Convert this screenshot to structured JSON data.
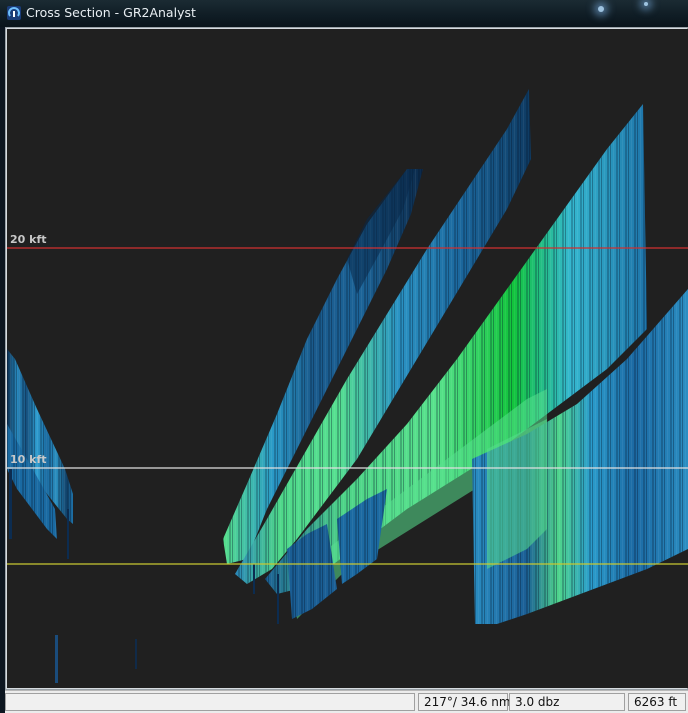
{
  "window": {
    "title": "Cross Section - GR2Analyst"
  },
  "cross_section": {
    "altitude_lines": [
      {
        "label": "20 kft",
        "color": "#d03030"
      },
      {
        "label": "10 kft",
        "color": "#d8d8d8"
      },
      {
        "label": "",
        "color": "#c8c832"
      }
    ],
    "background": "#202020"
  },
  "status": {
    "left_cell": "",
    "position": "217°/ 34.6 nmi",
    "value": "3.0 dbz",
    "blank": "",
    "height": "6263 ft"
  },
  "colors": {
    "dark_blue": "#0a2c50",
    "mid_blue": "#1e6ea6",
    "cyan_blue": "#2e9ccc",
    "light_green": "#57e08a",
    "green": "#10c43a"
  }
}
